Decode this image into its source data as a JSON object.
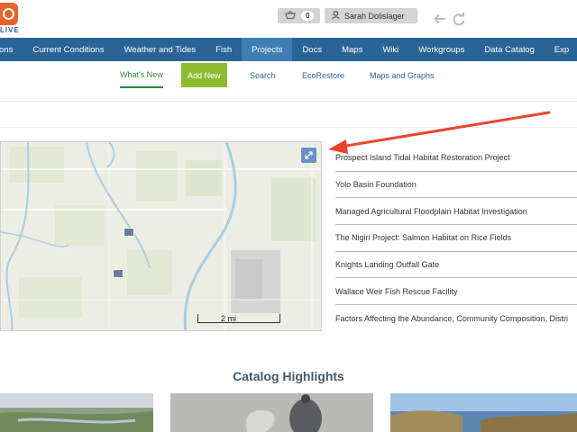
{
  "header": {
    "logo_text": "LIVE",
    "cart_count": "0",
    "user_name": "Sarah Dolislager"
  },
  "main_nav": [
    {
      "label": "ations",
      "active": false
    },
    {
      "label": "Current Conditions",
      "active": false
    },
    {
      "label": "Weather and Tides",
      "active": false
    },
    {
      "label": "Fish",
      "active": false
    },
    {
      "label": "Projects",
      "active": true
    },
    {
      "label": "Docs",
      "active": false
    },
    {
      "label": "Maps",
      "active": false
    },
    {
      "label": "Wiki",
      "active": false
    },
    {
      "label": "Workgroups",
      "active": false
    },
    {
      "label": "Data Catalog",
      "active": false
    },
    {
      "label": "Exp",
      "active": false
    }
  ],
  "sub_nav": [
    {
      "label": "What's New",
      "state": "active"
    },
    {
      "label": "Add New",
      "state": "button"
    },
    {
      "label": "Search",
      "state": "normal"
    },
    {
      "label": "EcoRestore",
      "state": "normal"
    },
    {
      "label": "Maps and Graphs",
      "state": "normal"
    }
  ],
  "map": {
    "scale_label": "2 mi"
  },
  "projects": [
    "Prospect Island Tidal Habitat Restoration Project",
    "Yolo Basin Foundation",
    "Managed Agricultural Floodplain Habitat Investigation",
    "The Nigiri Project: Salmon Habitat on Rice Fields",
    "Knights Landing Outfall Gate",
    "Wallace Weir Fish Rescue Facility",
    "Factors Affecting the Abundance, Community Composition, Distri"
  ],
  "catalog": {
    "title": "Catalog Highlights"
  },
  "colors": {
    "nav_bg": "#2a6496",
    "nav_active": "#3f7db5",
    "add_new_bg": "#8dbb30",
    "accent_orange": "#e8642c",
    "annotation_red": "#e8452c"
  },
  "icons": {
    "cart": "basket-icon",
    "user": "user-icon",
    "undo": "undo-arrow-icon",
    "redo": "redo-arrow-icon",
    "expand": "expand-icon"
  }
}
